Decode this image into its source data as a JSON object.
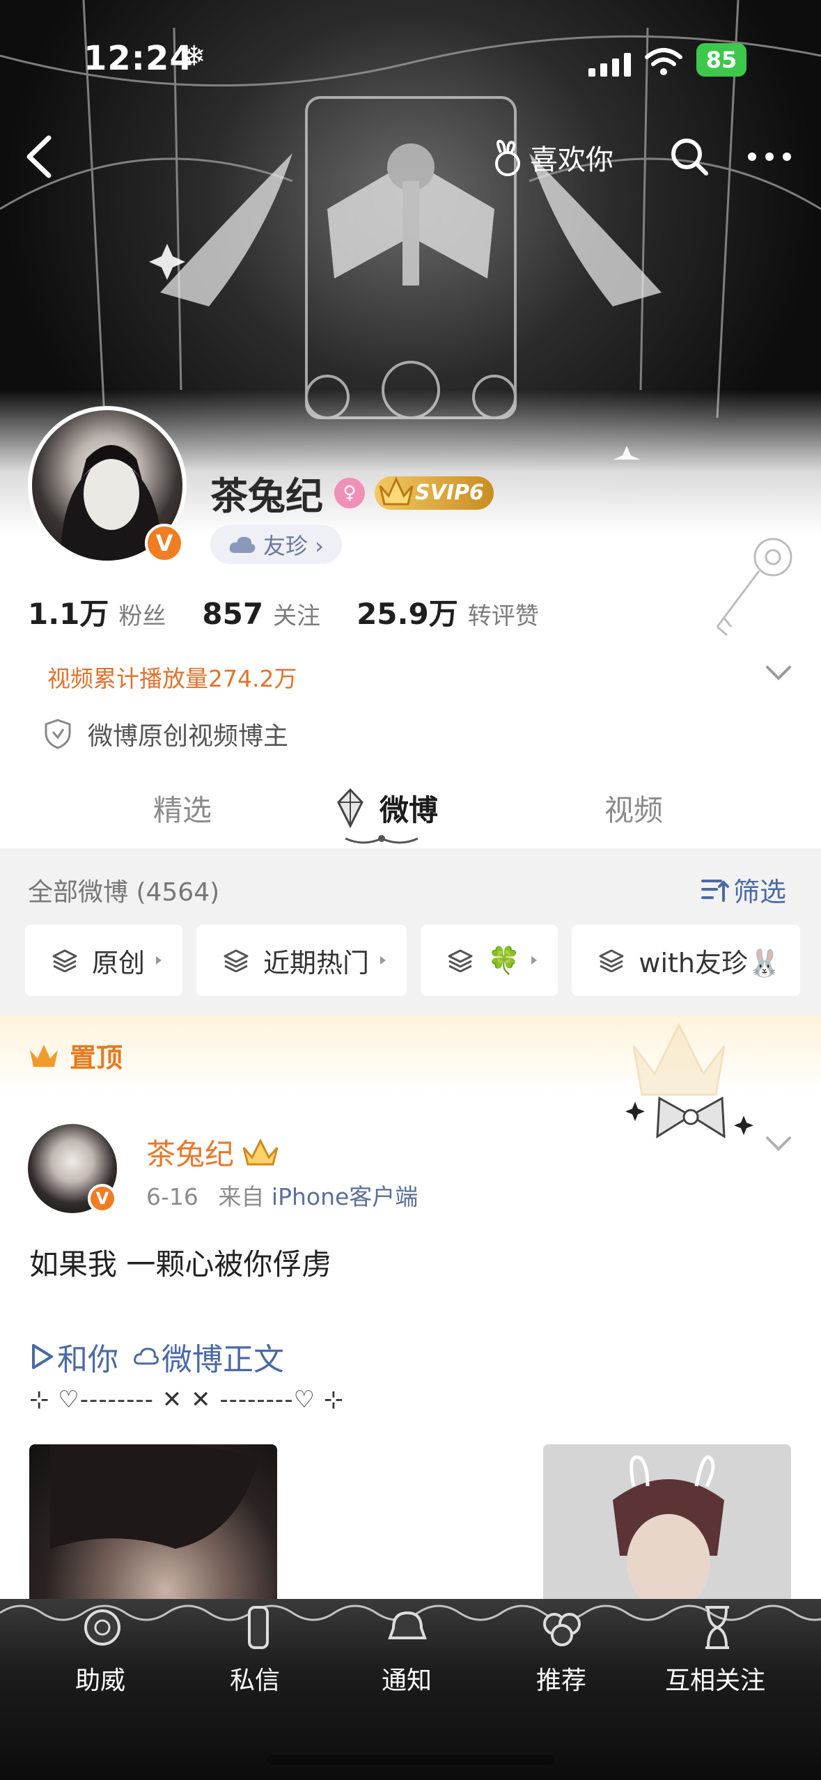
{
  "status_bar": {
    "time": "12:24",
    "snow_icon": "snowflake-icon",
    "battery": "85"
  },
  "nav": {
    "like_label": "喜欢你"
  },
  "profile": {
    "name": "茶兔纪",
    "svip_label": "SVIP6",
    "friend_chip": "友珍 ›",
    "verified_badge": "V",
    "stats": [
      {
        "num": "1.1万",
        "label": "粉丝"
      },
      {
        "num": "857",
        "label": "关注"
      },
      {
        "num": "25.9万",
        "label": "转评赞"
      }
    ],
    "video_plays": "视频累计播放量274.2万",
    "certification": "微博原创视频博主"
  },
  "tabs": [
    "精选",
    "微博",
    "视频"
  ],
  "feed": {
    "all_label": "全部微博 (4564)",
    "filter_label": "筛选",
    "chips": [
      {
        "label": "原创"
      },
      {
        "label": "近期热门"
      },
      {
        "label": "🍀"
      },
      {
        "label": "with友珍🐰"
      }
    ],
    "pinned_label": "置顶"
  },
  "post": {
    "author": "茶兔纪",
    "badge": "V",
    "date": "6-16",
    "from_prefix": "来自",
    "source": "iPhone客户端",
    "text": "如果我 一颗心被你俘虏",
    "link1": "和你",
    "link2": "微博正文",
    "deco_line": "⊹ ♡-------- ✕ ✕ --------♡ ⊹"
  },
  "bottom_nav": [
    "助威",
    "私信",
    "通知",
    "推荐",
    "互相关注"
  ],
  "colors": {
    "accent_orange": "#e8782a",
    "link_blue": "#4a6aa4",
    "vip_gold": "#d9a23a",
    "battery_green": "#3ec84b"
  }
}
